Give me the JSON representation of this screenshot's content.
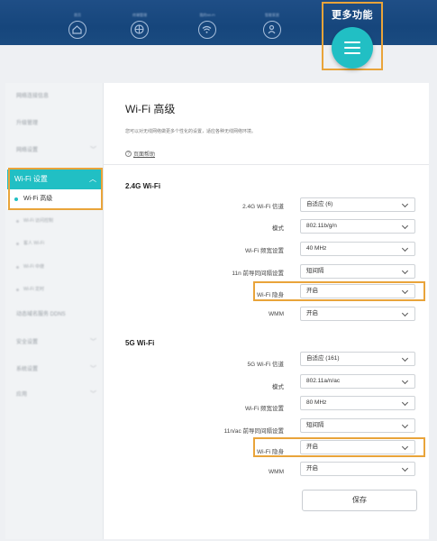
{
  "topnav": {
    "items": [
      {
        "label": "首页",
        "icon": "home-icon"
      },
      {
        "label": "终端管理",
        "icon": "globe-icon"
      },
      {
        "label": "我的Wi-Fi",
        "icon": "wifi-icon"
      },
      {
        "label": "智能家居",
        "icon": "user-icon"
      }
    ],
    "more": {
      "label": "更多功能",
      "icon": "menu-icon"
    }
  },
  "sidebar": {
    "items_top": [
      {
        "label": "网络连接信息"
      },
      {
        "label": "升级管理"
      },
      {
        "label": "网络设置"
      }
    ],
    "active_group": {
      "label": "Wi-Fi 设置"
    },
    "active_sub": {
      "label": "Wi-Fi 高级"
    },
    "sub_items": [
      {
        "label": "Wi-Fi 访问控制"
      },
      {
        "label": "客人 Wi-Fi"
      },
      {
        "label": "Wi-Fi 中继"
      },
      {
        "label": "Wi-Fi 定时"
      }
    ],
    "items_bottom": [
      {
        "label": "动态域名服务 DDNS"
      },
      {
        "label": "安全设置"
      },
      {
        "label": "系统设置"
      },
      {
        "label": "应用"
      }
    ]
  },
  "content": {
    "title": "Wi-Fi 高级",
    "description": "您可以对无线网络做更多个性化的设置，适应各种无线网络环境。",
    "help": "页面帮助",
    "section_24g": {
      "title": "2.4G Wi-Fi",
      "rows": [
        {
          "label": "2.4G Wi-Fi 信道",
          "value": "自适应 (6)"
        },
        {
          "label": "模式",
          "value": "802.11b/g/n"
        },
        {
          "label": "Wi-Fi 频宽设置",
          "value": "40 MHz"
        },
        {
          "label": "11n 前导同间隔设置",
          "value": "短间隔"
        },
        {
          "label": "Wi-Fi 隐身",
          "value": "开启"
        },
        {
          "label": "WMM",
          "value": "开启"
        }
      ]
    },
    "section_5g": {
      "title": "5G Wi-Fi",
      "rows": [
        {
          "label": "5G Wi-Fi 信道",
          "value": "自适应 (161)"
        },
        {
          "label": "模式",
          "value": "802.11a/n/ac"
        },
        {
          "label": "Wi-Fi 频宽设置",
          "value": "80 MHz"
        },
        {
          "label": "11n/ac 前导同间隔设置",
          "value": "短间隔"
        },
        {
          "label": "Wi-Fi 隐身",
          "value": "开启"
        },
        {
          "label": "WMM",
          "value": "开启"
        }
      ]
    },
    "save_label": "保存"
  },
  "colors": {
    "nav_bg": "#1a4b80",
    "accent_teal": "#21bfc4",
    "highlight_orange": "#e9a43a"
  }
}
